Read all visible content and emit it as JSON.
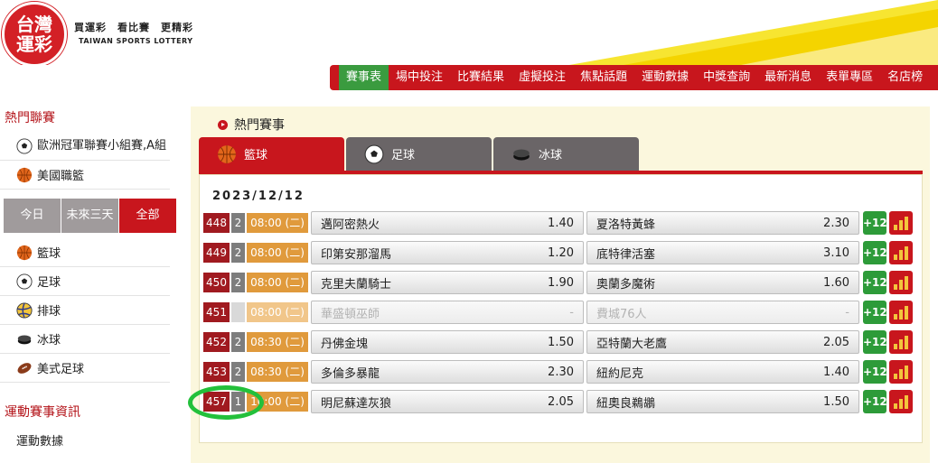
{
  "header": {
    "logo_line1": "台灣",
    "logo_line2": "運彩",
    "slogan": "買運彩　看比賽　更精彩",
    "slogan_en": "TAIWAN SPORTS LOTTERY"
  },
  "nav": [
    "賽事表",
    "場中投注",
    "比賽結果",
    "虛擬投注",
    "焦點話題",
    "運動數據",
    "中獎查詢",
    "最新消息",
    "表單專區",
    "名店榜"
  ],
  "sidebar": {
    "hot_title": "熱門聯賽",
    "hot_items": [
      {
        "label": "歐洲冠軍聯賽小組賽,A組",
        "icon": "soccer-ball-icon"
      },
      {
        "label": "美國職籃",
        "icon": "basketball-icon"
      }
    ],
    "filters": [
      "今日",
      "未來三天",
      "全部"
    ],
    "sports": [
      {
        "label": "籃球",
        "icon": "basketball-icon"
      },
      {
        "label": "足球",
        "icon": "soccer-ball-icon"
      },
      {
        "label": "排球",
        "icon": "volleyball-icon"
      },
      {
        "label": "冰球",
        "icon": "hockey-puck-icon"
      },
      {
        "label": "美式足球",
        "icon": "football-icon"
      }
    ],
    "info_title": "運動賽事資訊",
    "info_partial": "運動數據"
  },
  "main": {
    "title": "熱門賽事",
    "tabs": [
      {
        "label": "籃球",
        "icon": "basketball-icon"
      },
      {
        "label": "足球",
        "icon": "soccer-ball-icon"
      },
      {
        "label": "冰球",
        "icon": "hockey-puck-icon"
      }
    ],
    "date": "2023/12/12",
    "more_label": "+12",
    "games": [
      {
        "num": "448",
        "count": "2",
        "time": "08:00 (二)",
        "home": "邁阿密熱火",
        "home_odds": "1.40",
        "away": "夏洛特黃蜂",
        "away_odds": "2.30",
        "disabled": false
      },
      {
        "num": "449",
        "count": "2",
        "time": "08:00 (二)",
        "home": "印第安那溜馬",
        "home_odds": "1.20",
        "away": "底特律活塞",
        "away_odds": "3.10",
        "disabled": false
      },
      {
        "num": "450",
        "count": "2",
        "time": "08:00 (二)",
        "home": "克里夫蘭騎士",
        "home_odds": "1.90",
        "away": "奧蘭多魔術",
        "away_odds": "1.60",
        "disabled": false
      },
      {
        "num": "451",
        "count": "",
        "time": "08:00 (二)",
        "home": "華盛頓巫師",
        "home_odds": "-",
        "away": "費城76人",
        "away_odds": "-",
        "disabled": true
      },
      {
        "num": "452",
        "count": "2",
        "time": "08:30 (二)",
        "home": "丹佛金塊",
        "home_odds": "1.50",
        "away": "亞特蘭大老鷹",
        "away_odds": "2.05",
        "disabled": false
      },
      {
        "num": "453",
        "count": "2",
        "time": "08:30 (二)",
        "home": "多倫多暴龍",
        "home_odds": "2.30",
        "away": "紐約尼克",
        "away_odds": "1.40",
        "disabled": false
      },
      {
        "num": "457",
        "count": "1",
        "time": "10:00 (二)",
        "home": "明尼蘇達灰狼",
        "home_odds": "2.05",
        "away": "紐奧良鵜鶘",
        "away_odds": "1.50",
        "disabled": false
      }
    ]
  },
  "colors": {
    "brand_red": "#c8161d",
    "nav_active": "#3a9b3f",
    "time_orange": "#e09a3c",
    "annotation": "#23c03b"
  }
}
